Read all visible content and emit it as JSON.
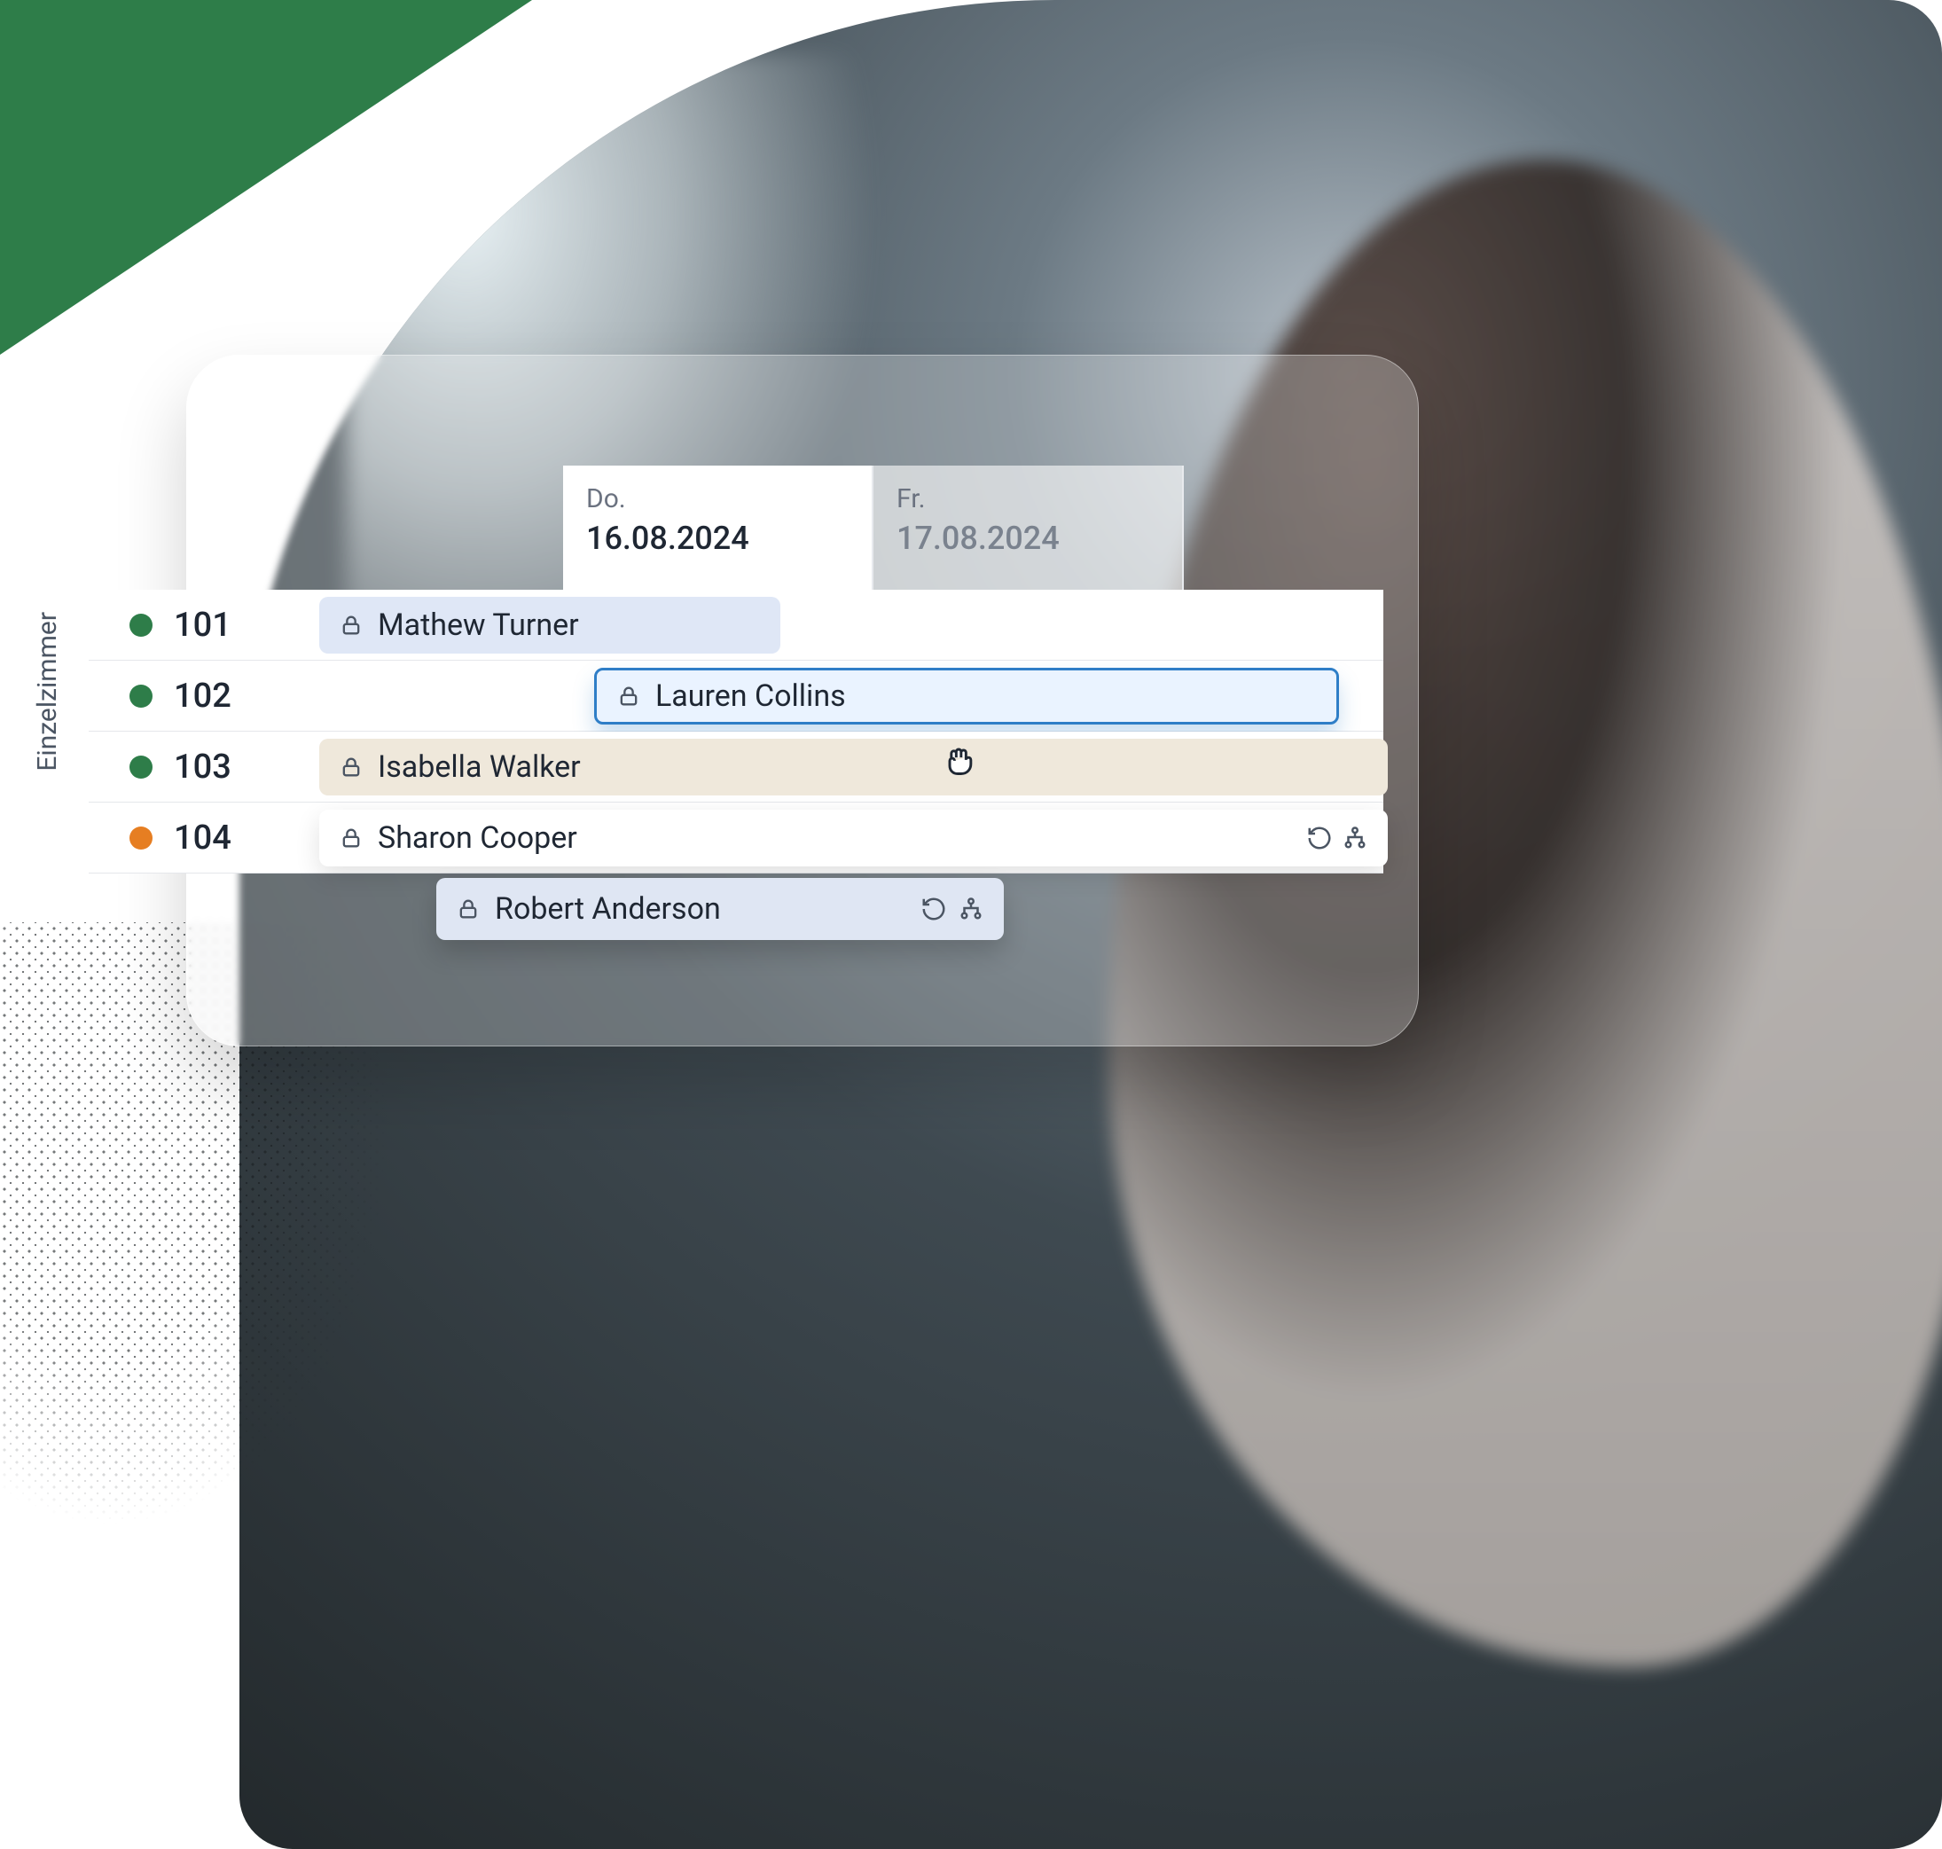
{
  "category_label": "Einzelzimmer",
  "dates": [
    {
      "day_label": "Do.",
      "date": "16.08.2024",
      "active": true
    },
    {
      "day_label": "Fr.",
      "date": "17.08.2024",
      "active": false
    }
  ],
  "rooms": [
    {
      "number": "101",
      "status": "green"
    },
    {
      "number": "102",
      "status": "green"
    },
    {
      "number": "103",
      "status": "green"
    },
    {
      "number": "104",
      "status": "orange"
    }
  ],
  "bookings": {
    "p1": "Mathew Turner",
    "p2": "Lauren Collins",
    "p3": "Isabella Walker",
    "p4": "Sharon Cooper",
    "floating": "Robert Anderson"
  },
  "colors": {
    "green": "#2e7d49",
    "orange": "#e67e22",
    "accent": "#2f7ec7"
  }
}
